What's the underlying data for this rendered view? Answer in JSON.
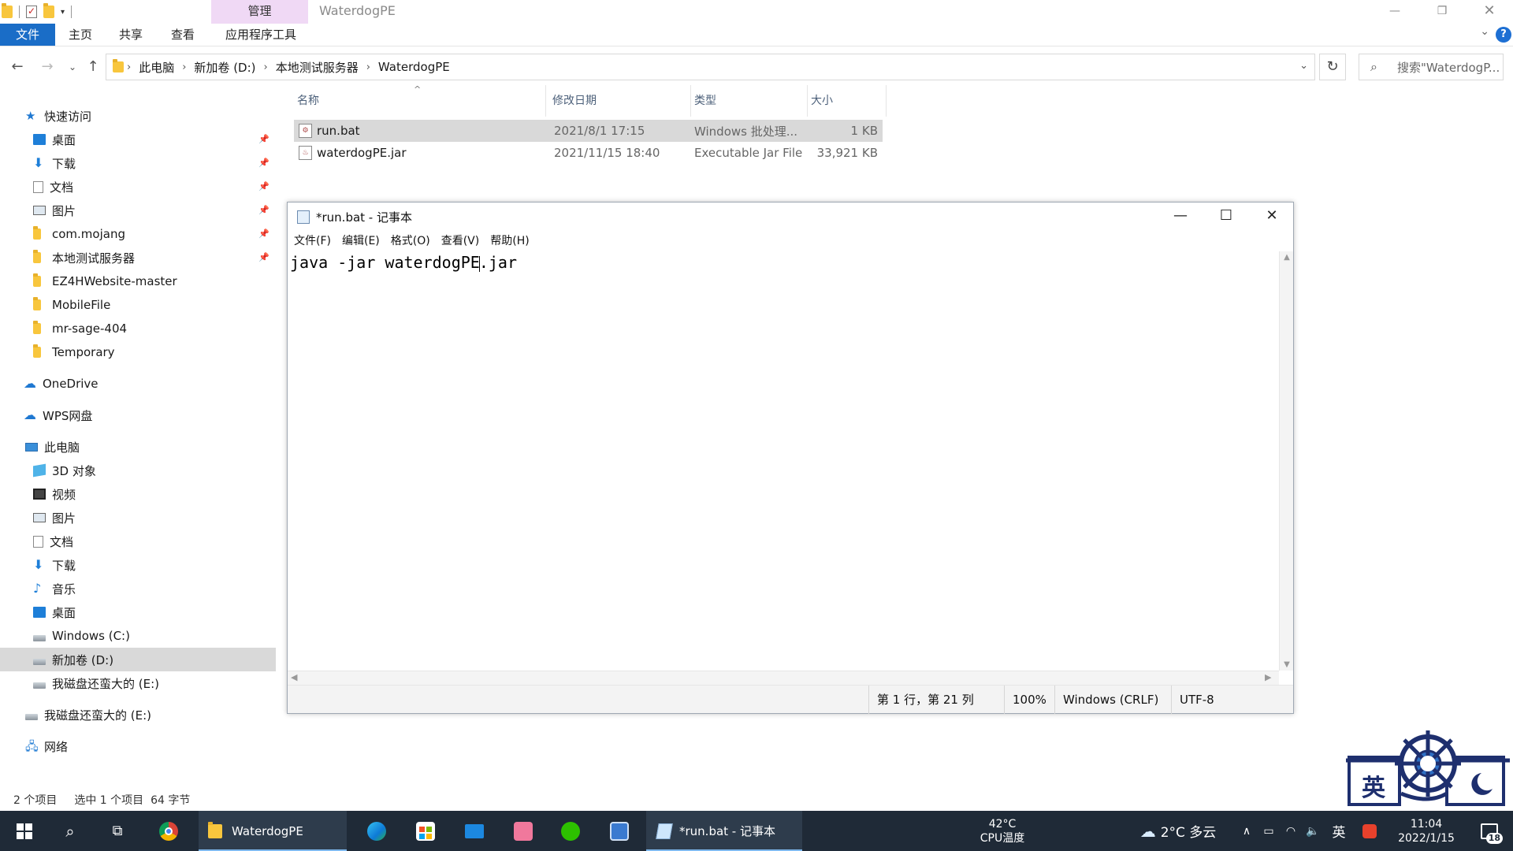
{
  "explorer": {
    "window_title": "WaterdogPE",
    "manage_tab": "管理",
    "ribbon_tabs": [
      "文件",
      "主页",
      "共享",
      "查看",
      "应用程序工具"
    ],
    "breadcrumb": [
      "此电脑",
      "新加卷 (D:)",
      "本地测试服务器",
      "WaterdogPE"
    ],
    "search_placeholder": "搜索\"WaterdogP...",
    "nav": {
      "quick_access": "快速访问",
      "quick_items": [
        {
          "label": "桌面",
          "icon": "desktop-icon",
          "pinned": true
        },
        {
          "label": "下载",
          "icon": "download-icon",
          "pinned": true
        },
        {
          "label": "文档",
          "icon": "document-icon",
          "pinned": true
        },
        {
          "label": "图片",
          "icon": "picture-icon",
          "pinned": true
        },
        {
          "label": "com.mojang",
          "icon": "folder-icon",
          "pinned": true
        },
        {
          "label": "本地测试服务器",
          "icon": "folder-icon",
          "pinned": true
        },
        {
          "label": "EZ4HWebsite-master",
          "icon": "folder-icon",
          "pinned": false
        },
        {
          "label": "MobileFile",
          "icon": "folder-icon",
          "pinned": false
        },
        {
          "label": "mr-sage-404",
          "icon": "folder-icon",
          "pinned": false
        },
        {
          "label": "Temporary",
          "icon": "folder-icon",
          "pinned": false
        }
      ],
      "onedrive": "OneDrive",
      "wps": "WPS网盘",
      "this_pc": "此电脑",
      "pc_items": [
        {
          "label": "3D 对象",
          "icon": "3d-objects-icon"
        },
        {
          "label": "视频",
          "icon": "video-icon"
        },
        {
          "label": "图片",
          "icon": "picture-icon"
        },
        {
          "label": "文档",
          "icon": "document-icon"
        },
        {
          "label": "下载",
          "icon": "download-icon"
        },
        {
          "label": "音乐",
          "icon": "music-icon"
        },
        {
          "label": "桌面",
          "icon": "desktop-icon"
        },
        {
          "label": "Windows (C:)",
          "icon": "drive-icon"
        },
        {
          "label": "新加卷 (D:)",
          "icon": "drive-icon"
        },
        {
          "label": "我磁盘还蛮大的 (E:)",
          "icon": "drive-icon"
        }
      ],
      "extra_drive": "我磁盘还蛮大的 (E:)",
      "network": "网络"
    },
    "columns": {
      "name": "名称",
      "date": "修改日期",
      "type": "类型",
      "size": "大小"
    },
    "files": [
      {
        "name": "run.bat",
        "date": "2021/8/1 17:15",
        "type": "Windows 批处理...",
        "size": "1 KB"
      },
      {
        "name": "waterdogPE.jar",
        "date": "2021/11/15 18:40",
        "type": "Executable Jar File",
        "size": "33,921 KB"
      }
    ],
    "status": {
      "count": "2 个项目",
      "selection": "选中 1 个项目  64 字节"
    }
  },
  "notepad": {
    "title": "*run.bat - 记事本",
    "menu": [
      "文件(F)",
      "编辑(E)",
      "格式(O)",
      "查看(V)",
      "帮助(H)"
    ],
    "text_before_caret": "java -jar waterdogPE",
    "text_after_caret": ".jar",
    "status": {
      "position": "第 1 行，第 21 列",
      "zoom": "100%",
      "line_ending": "Windows (CRLF)",
      "encoding": "UTF-8"
    }
  },
  "emblem": {
    "char": "英"
  },
  "taskbar": {
    "apps": [
      {
        "label": "WaterdogPE",
        "icon": "explorer-icon"
      },
      {
        "label": "*run.bat - 记事本",
        "icon": "notepad-icon"
      }
    ],
    "cpu_temp": "42°C",
    "cpu_label": "CPU温度",
    "weather": "2°C 多云",
    "ime": "英",
    "time": "11:04",
    "date": "2022/1/15",
    "notifications": "18"
  },
  "colors": {
    "accent": "#1a6dc7",
    "manage_tab": "#f0d9f5",
    "taskbar": "#1f2a37",
    "selection": "#d9d9d9"
  }
}
